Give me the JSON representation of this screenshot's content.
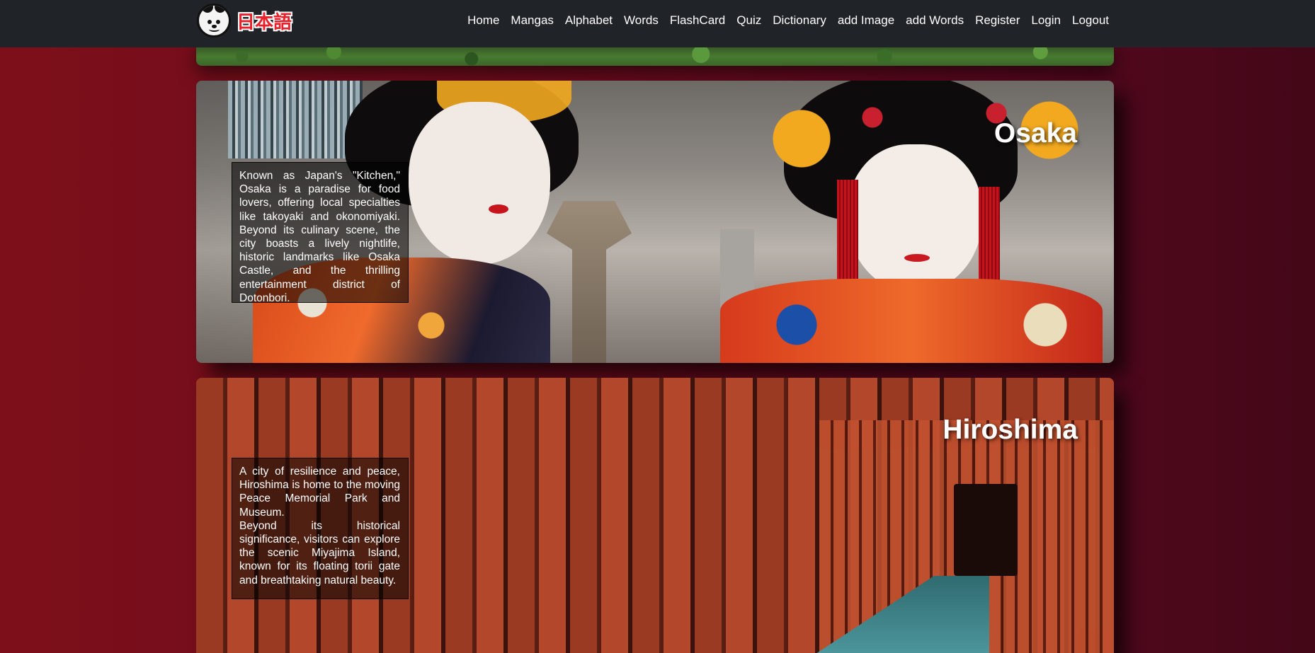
{
  "brand": {
    "text": "日本語",
    "logo_icon": "panda-icon"
  },
  "nav": {
    "links": [
      "Home",
      "Mangas",
      "Alphabet",
      "Words",
      "FlashCard",
      "Quiz",
      "Dictionary",
      "add Image",
      "add Words",
      "Register",
      "Login",
      "Logout"
    ]
  },
  "cities": [
    {
      "title": "Osaka",
      "description": [
        "Known as Japan's \"Kitchen,\" Osaka is a paradise for food lovers, offering local specialties like takoyaki and okonomiyaki. Beyond its culinary scene, the city boasts a lively nightlife, historic landmarks like Osaka Castle, and the thrilling entertainment district of Dotonbori."
      ]
    },
    {
      "title": "Hiroshima",
      "description": [
        "A city of resilience and peace, Hiroshima is home to the moving Peace Memorial Park and Museum.",
        "Beyond its historical significance, visitors can explore the scenic Miyajima Island, known for its floating torii gate and breathtaking natural beauty."
      ]
    }
  ],
  "colors": {
    "navbar": "#202327",
    "background_start": "#7d0f1a",
    "background_end": "#430718",
    "brand_red": "#e8202a"
  }
}
